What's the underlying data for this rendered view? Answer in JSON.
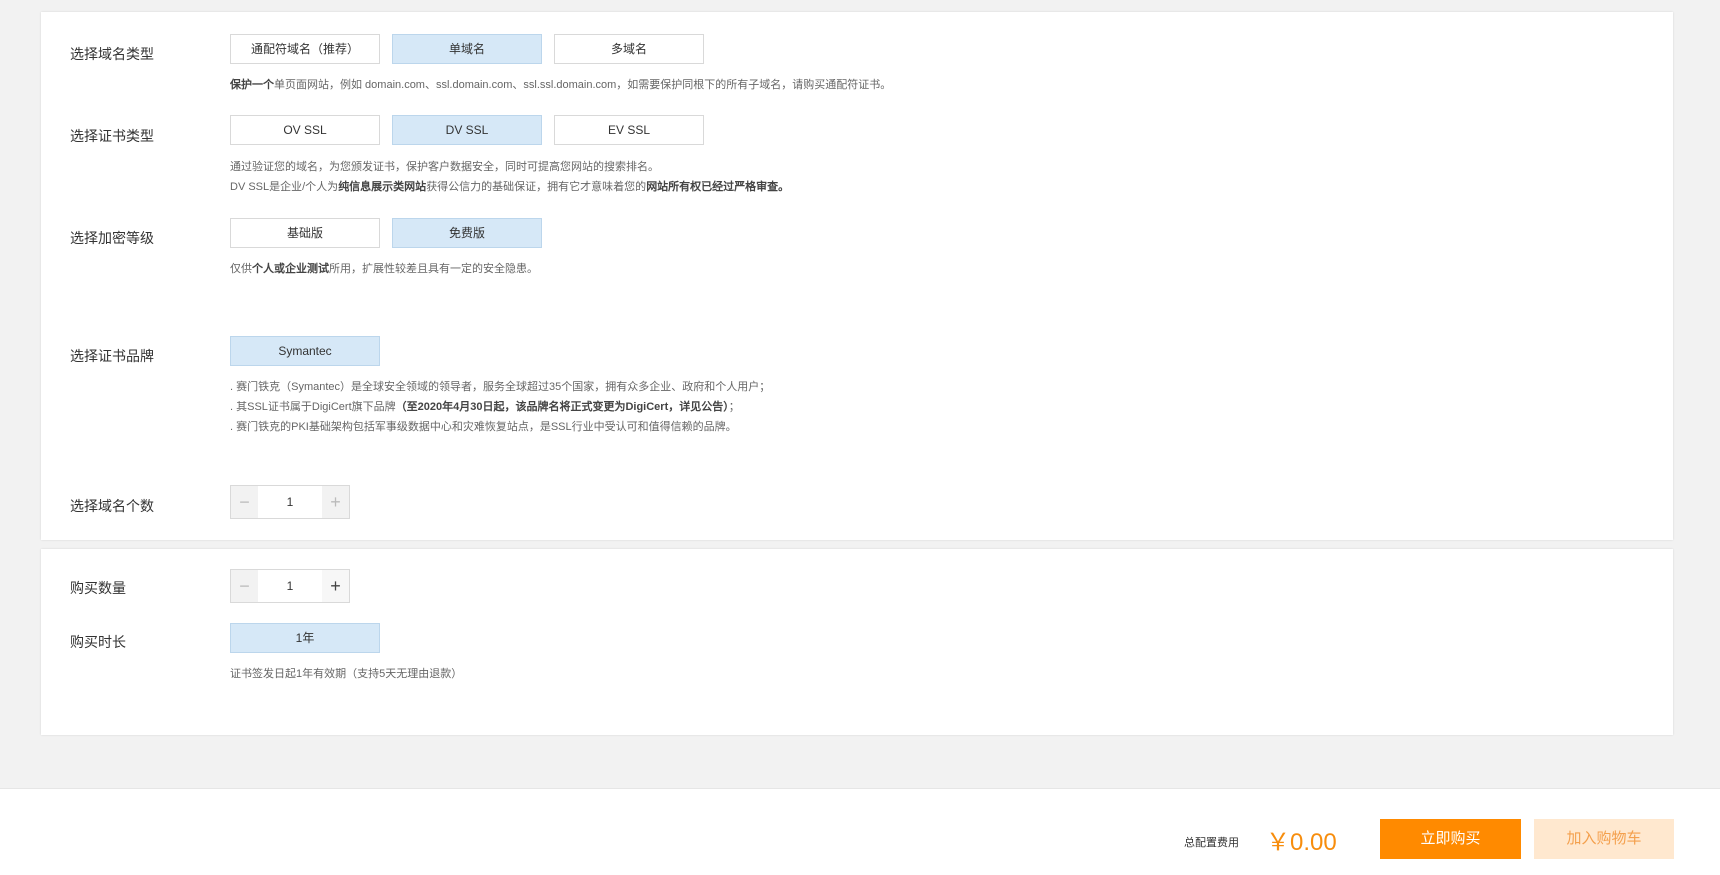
{
  "domain_type": {
    "label": "选择域名类型",
    "options": [
      "通配符域名（推荐）",
      "单域名",
      "多域名"
    ],
    "selected_index": 1,
    "desc_bold": "保护一个",
    "desc_rest": "单页面网站，例如 domain.com、ssl.domain.com、ssl.ssl.domain.com，如需要保护同根下的所有子域名，请购买通配符证书。"
  },
  "cert_type": {
    "label": "选择证书类型",
    "options": [
      "OV SSL",
      "DV SSL",
      "EV SSL"
    ],
    "selected_index": 1,
    "desc_line1": "通过验证您的域名，为您颁发证书，保护客户数据安全，同时可提高您网站的搜索排名。",
    "desc_line2_a": "DV SSL是企业/个人为",
    "desc_line2_b": "纯信息展示类网站",
    "desc_line2_c": "获得公信力的基础保证，拥有它才意味着您的",
    "desc_line2_d": "网站所有权已经过严格审查。"
  },
  "encryption_level": {
    "label": "选择加密等级",
    "options": [
      "基础版",
      "免费版"
    ],
    "selected_index": 1,
    "desc_a": "仅供",
    "desc_b": "个人或企业测试",
    "desc_c": "所用，扩展性较差且具有一定的安全隐患。"
  },
  "brand": {
    "label": "选择证书品牌",
    "option": "Symantec",
    "desc_line1": ". 赛门铁克（Symantec）是全球安全领域的领导者，服务全球超过35个国家，拥有众多企业、政府和个人用户；",
    "desc_line2_a": ". 其SSL证书属于DigiCert旗下品牌",
    "desc_line2_b": "（至2020年4月30日起，该品牌名将正式变更为DigiCert，详见公告）",
    "desc_line2_c": "；",
    "desc_line3": ". 赛门铁克的PKI基础架构包括军事级数据中心和灾难恢复站点，是SSL行业中受认可和值得信赖的品牌。"
  },
  "domain_count": {
    "label": "选择域名个数",
    "value": "1",
    "minus": "−",
    "plus": "+"
  },
  "purchase_qty": {
    "label": "购买数量",
    "value": "1",
    "minus": "−",
    "plus": "+"
  },
  "purchase_duration": {
    "label": "购买时长",
    "option": "1年",
    "desc": "证书签发日起1年有效期（支持5天无理由退款）"
  },
  "footer": {
    "total_label": "总配置费用",
    "total_price": "￥0.00",
    "buy_now": "立即购买",
    "add_cart": "加入购物车"
  },
  "colors": {
    "selected_bg": "#d6e8f7",
    "accent_orange": "#ff8a00",
    "price_orange": "#f78d0d",
    "cart_bg": "#ffe8cf"
  }
}
